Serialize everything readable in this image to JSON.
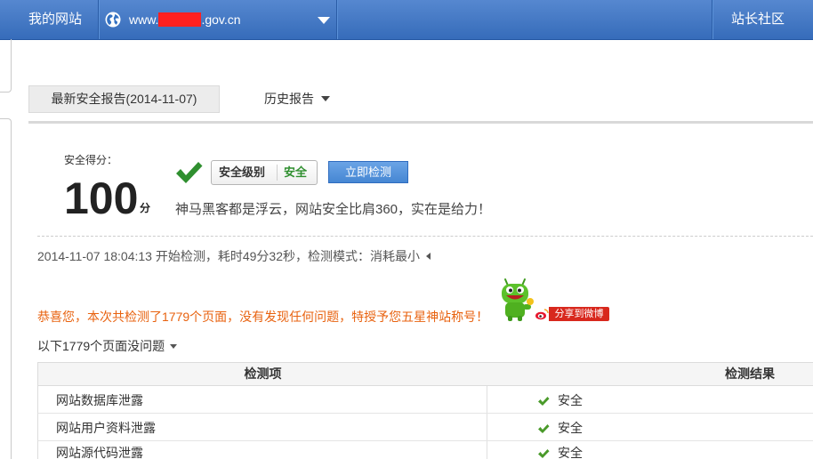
{
  "navbar": {
    "my_sites_label": "我的网站",
    "site_prefix": "www.",
    "site_suffix": ".gov.cn",
    "community_label": "站长社区"
  },
  "tabs": [
    {
      "label": "最新安全报告(2014-11-07)"
    },
    {
      "label": "历史报告"
    }
  ],
  "score": {
    "label": "安全得分：",
    "value": "100",
    "unit": "分",
    "level_label": "安全级别",
    "level_value": "安全",
    "scan_button_label": "立即检测",
    "slogan": "神马黑客都是浮云，网站安全比肩360，实在是给力！"
  },
  "scan_info": {
    "text": "2014-11-07 18:04:13 开始检测，耗时49分32秒，检测模式：消耗最小"
  },
  "result": {
    "congrats": "恭喜您，本次共检测了1779个页面，没有发现任何问题，特授予您五星神站称号！",
    "share_label": "分享到微博",
    "pages_ok_label": "以下1779个页面没问题"
  },
  "table": {
    "headers": [
      "检测项",
      "检测结果"
    ],
    "rows": [
      {
        "item": "网站数据库泄露",
        "result": "安全"
      },
      {
        "item": "网站用户资料泄露",
        "result": "安全"
      },
      {
        "item": "网站源代码泄露",
        "result": "安全"
      }
    ]
  },
  "icons": {
    "site": "globe-icon",
    "site_dropdown": "chevron-down-icon",
    "score_check": "check-icon",
    "result_check": "check-icon",
    "mascot": "mascot-icon",
    "share": "weibo-icon",
    "scan_info_toggle": "caret-left-icon",
    "pages_ok_toggle": "caret-down-icon",
    "history_dropdown": "caret-down-icon"
  },
  "colors": {
    "navbar": "#3a74c8",
    "safe_green": "#2f8f2f",
    "accent_orange": "#e8620f",
    "button_blue": "#4a8fe0",
    "redaction": "#ff2020",
    "weibo_red": "#d8281d"
  }
}
